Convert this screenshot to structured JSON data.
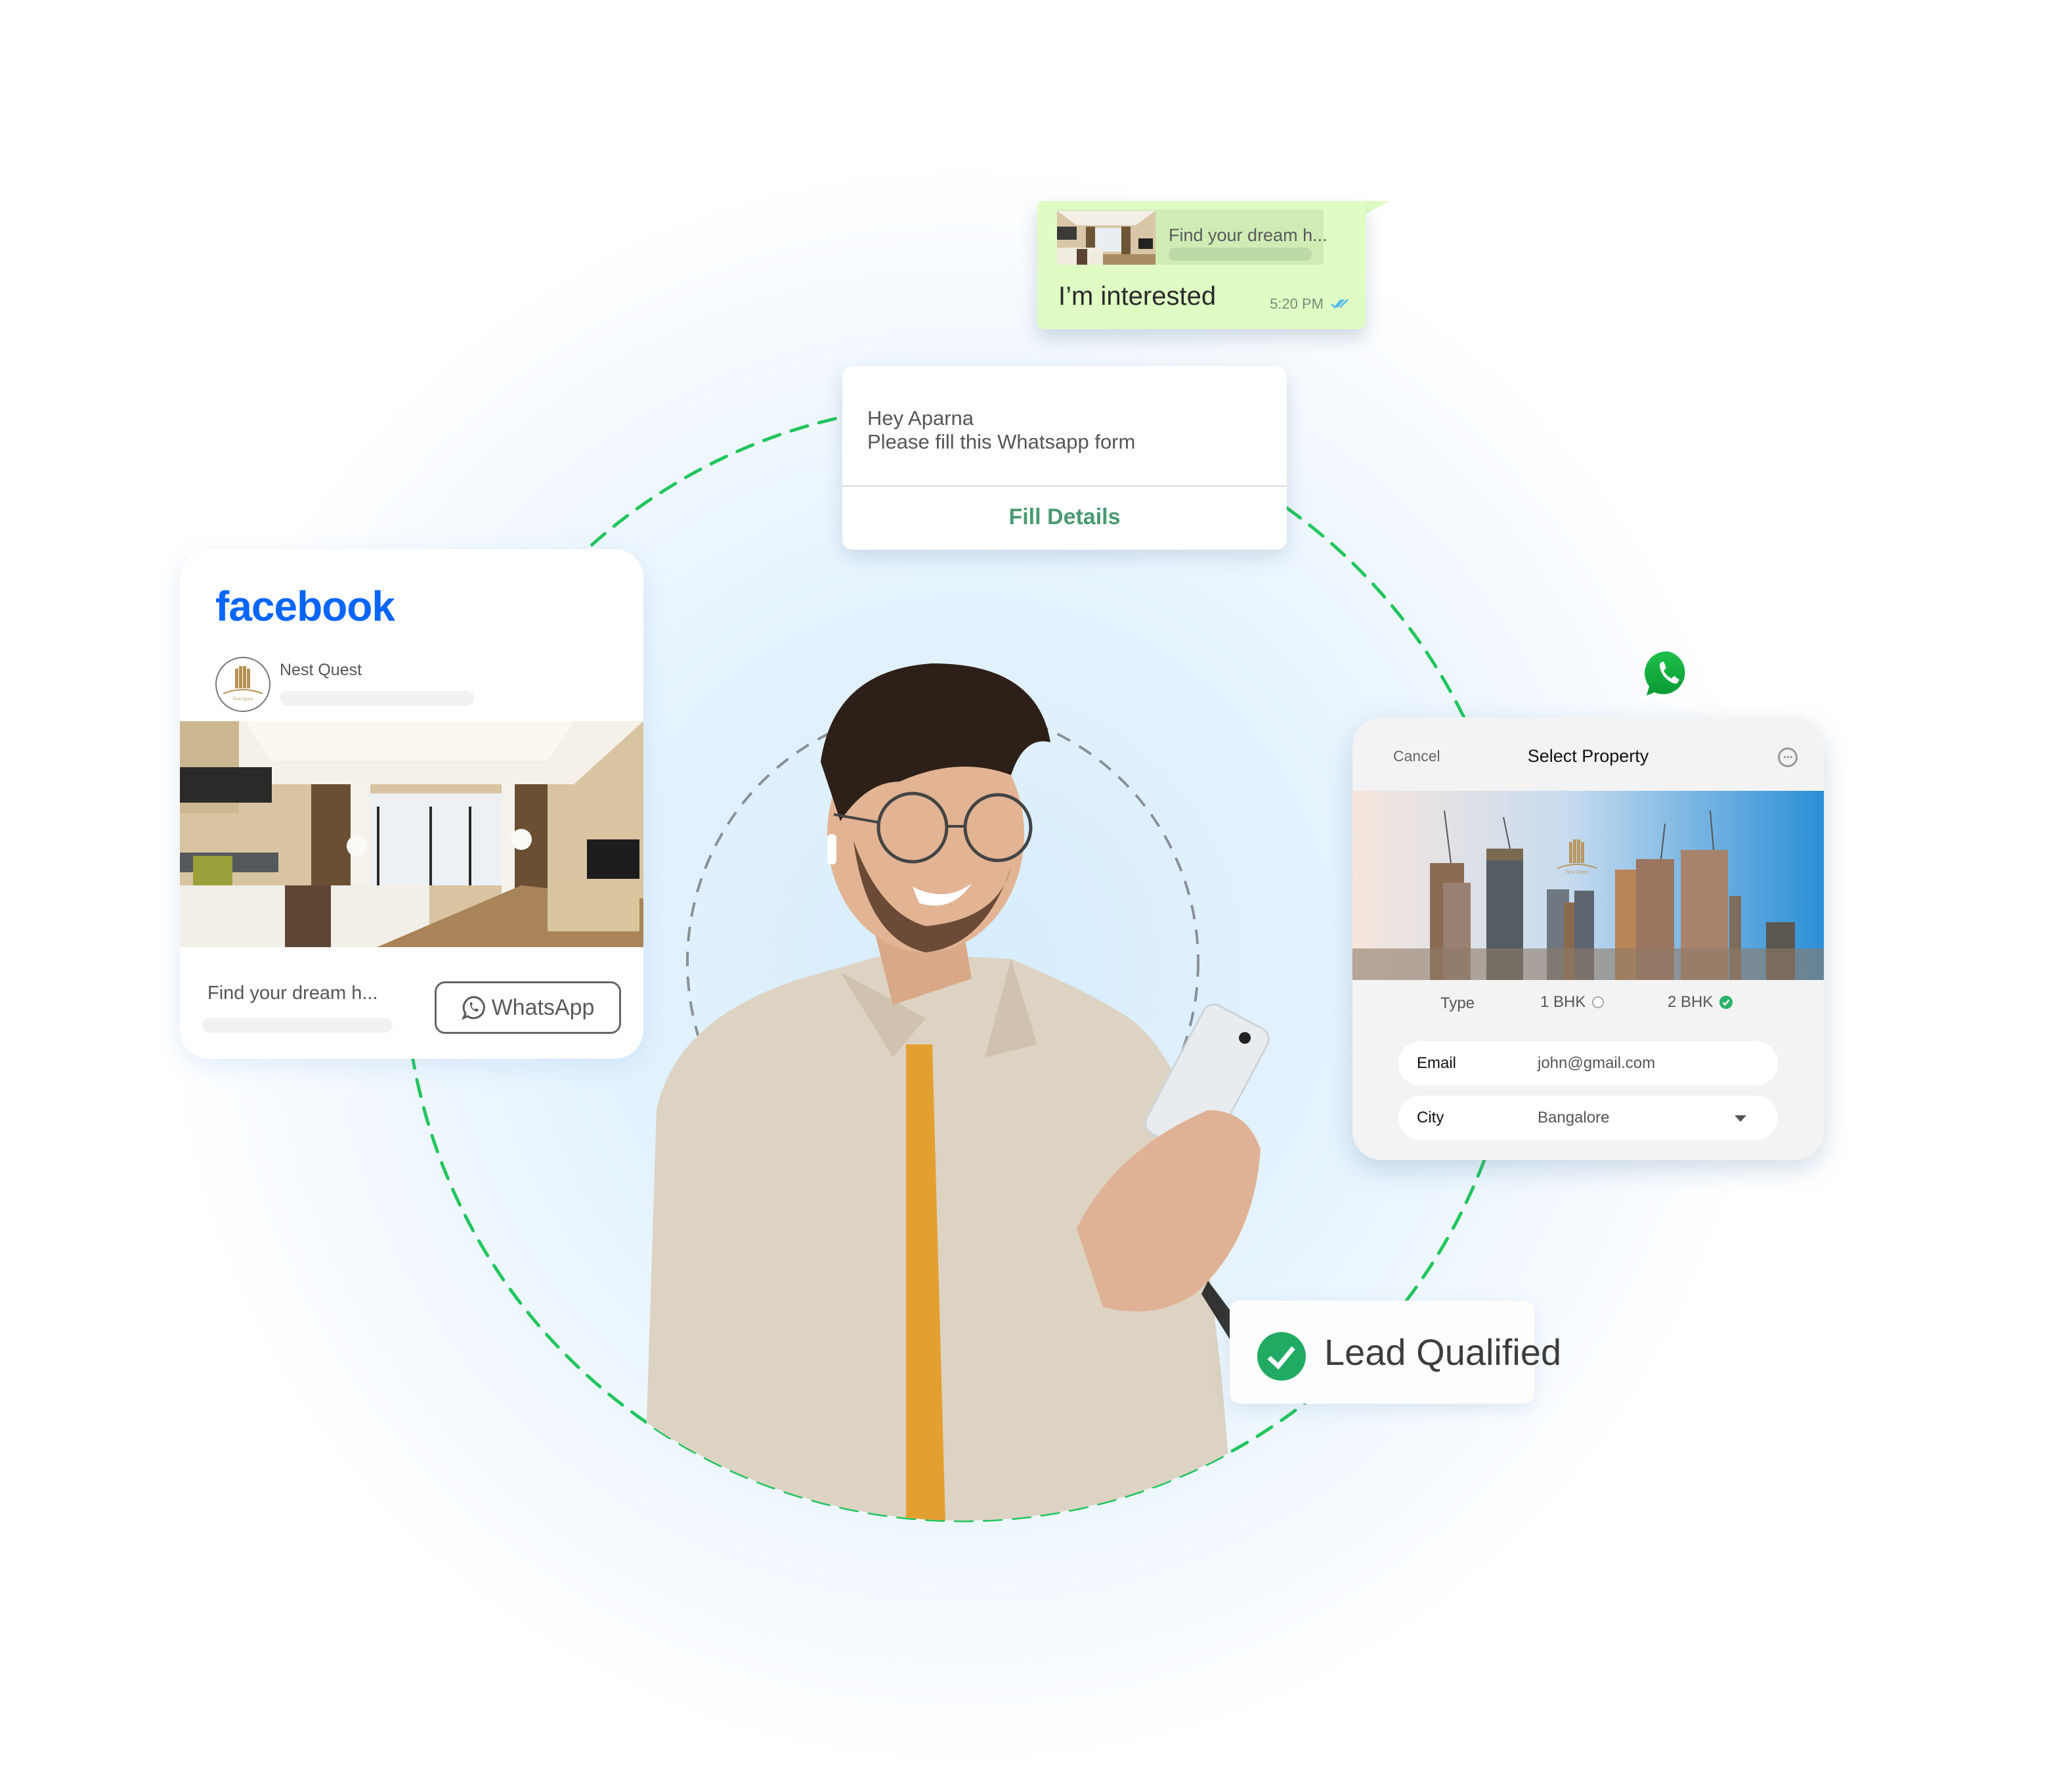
{
  "whatsapp_message": {
    "quoted_title": "Find your dream h...",
    "message": "I’m interested",
    "time": "5:20 PM",
    "read_receipt_icon": "double-check-icon",
    "bubble_color": "#dffcc4"
  },
  "form_prompt": {
    "greeting": "Hey Aparna",
    "body": "Please fill this Whatsapp form",
    "button_label": "Fill Details",
    "button_color": "#4a9a72"
  },
  "facebook_ad": {
    "brand": "facebook",
    "brand_color": "#0866ff",
    "page_name": "Nest Quest",
    "avatar_text": "Nest Quest",
    "caption": "Find your dream h...",
    "cta_label": "WhatsApp",
    "cta_icon": "whatsapp-icon"
  },
  "property_form": {
    "cancel_label": "Cancel",
    "title": "Select Property",
    "more_icon": "more-options-icon",
    "image_watermark": "Nest Quest",
    "type_label": "Type",
    "options": [
      {
        "label": "1 BHK",
        "selected": false
      },
      {
        "label": "2 BHK",
        "selected": true
      }
    ],
    "email": {
      "label": "Email",
      "value": "john@gmail.com"
    },
    "city": {
      "label": "City",
      "value": "Bangalore"
    }
  },
  "lead_status": {
    "label": "Lead Qualified",
    "icon": "check-circle-icon",
    "color": "#21ab62"
  },
  "floating_icon": "whatsapp-logo-icon",
  "accent_colors": {
    "dashed_ring": "#22c55e",
    "inner_ring": "#8a9097",
    "whatsapp_green": "#25d366"
  }
}
